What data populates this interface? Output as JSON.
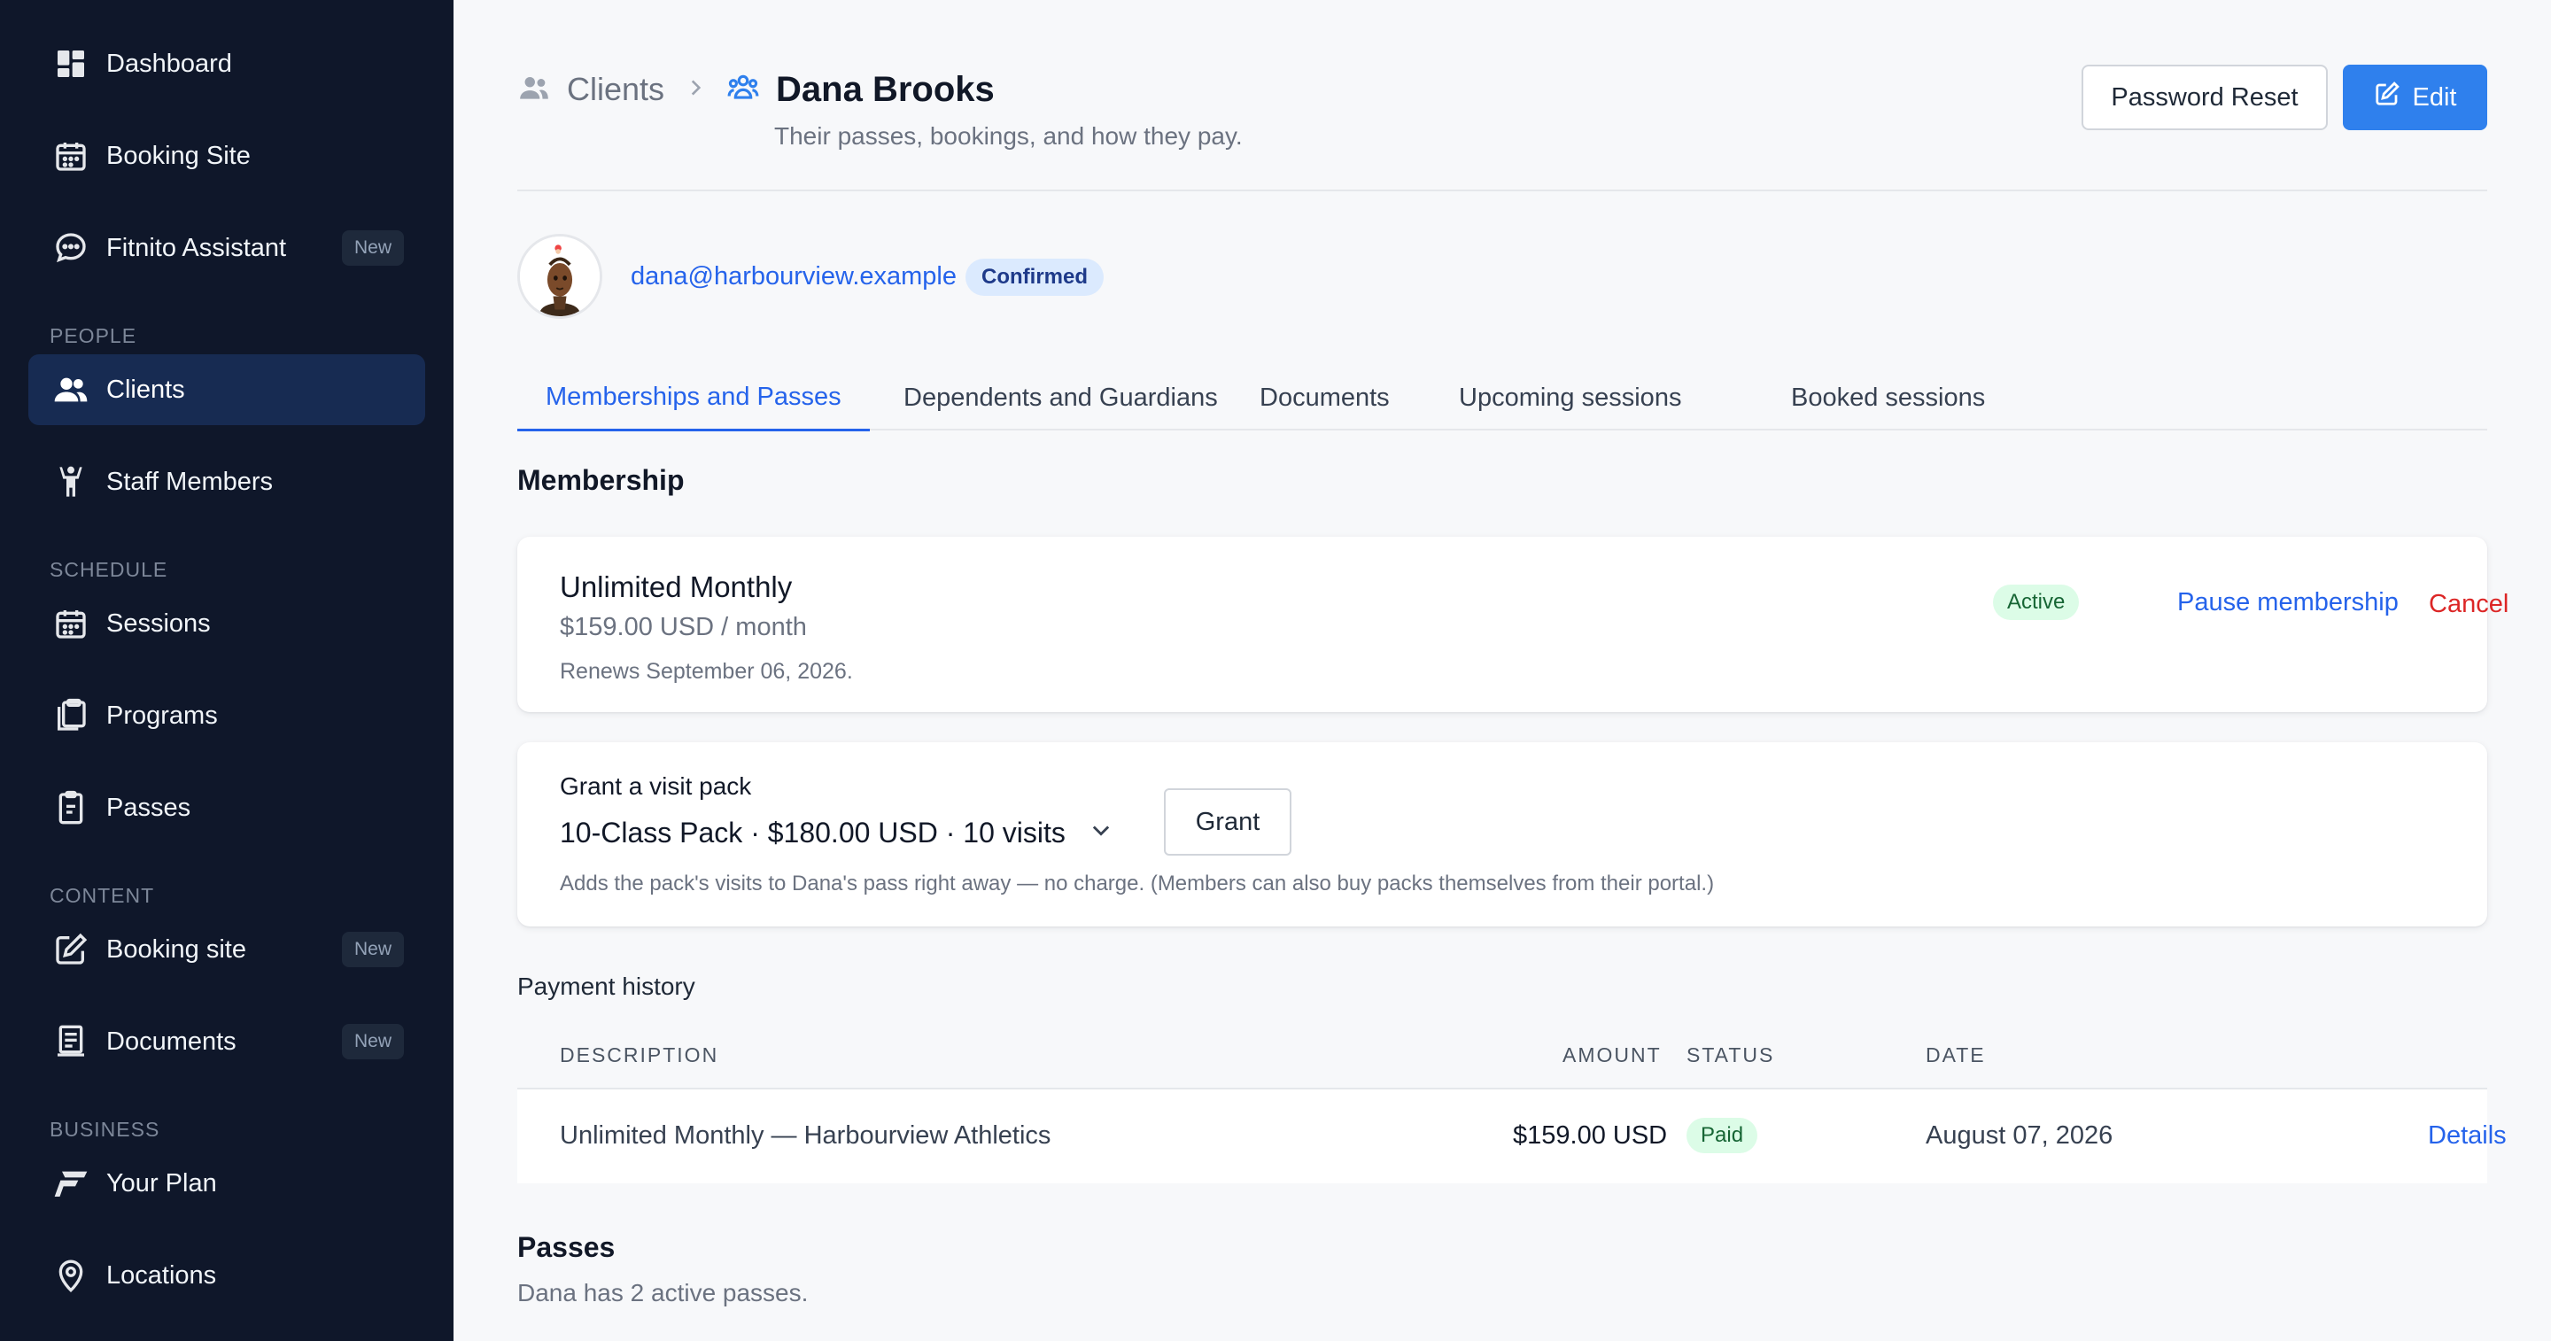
{
  "sidebar": {
    "items": [
      {
        "label": "Dashboard",
        "icon": "dashboard-icon"
      },
      {
        "label": "Booking Site",
        "icon": "calendar-icon"
      },
      {
        "label": "Fitnito Assistant",
        "icon": "chat-icon",
        "badge": "New"
      },
      {
        "label": "Clients",
        "icon": "users-icon",
        "active": true
      },
      {
        "label": "Staff Members",
        "icon": "staff-icon"
      },
      {
        "label": "Sessions",
        "icon": "calendar-icon"
      },
      {
        "label": "Programs",
        "icon": "clipboard-icon"
      },
      {
        "label": "Passes",
        "icon": "pass-icon"
      },
      {
        "label": "Booking site",
        "icon": "edit-icon",
        "badge": "New"
      },
      {
        "label": "Documents",
        "icon": "document-icon",
        "badge": "New"
      },
      {
        "label": "Your Plan",
        "icon": "fitnito-logo-icon"
      },
      {
        "label": "Locations",
        "icon": "location-icon"
      }
    ],
    "sections": {
      "people": "PEOPLE",
      "schedule": "SCHEDULE",
      "content": "CONTENT",
      "business": "BUSINESS"
    }
  },
  "header": {
    "breadcrumb_parent": "Clients",
    "title": "Dana Brooks",
    "subtitle": "Their passes, bookings, and how they pay.",
    "password_reset_label": "Password Reset",
    "edit_label": "Edit"
  },
  "profile": {
    "email": "dana@harbourview.example",
    "status": "Confirmed"
  },
  "tabs": [
    {
      "label": "Memberships and Passes",
      "active": true
    },
    {
      "label": "Dependents and Guardians"
    },
    {
      "label": "Documents"
    },
    {
      "label": "Upcoming sessions"
    },
    {
      "label": "Booked sessions"
    }
  ],
  "membership": {
    "heading": "Membership",
    "name": "Unlimited Monthly",
    "price": "$159.00 USD / month",
    "renews": "Renews September 06, 2026.",
    "status": "Active",
    "pause_label": "Pause membership",
    "cancel_label": "Cancel"
  },
  "grant": {
    "label": "Grant a visit pack",
    "selected": "10-Class Pack · $180.00 USD · 10 visits",
    "button": "Grant",
    "note": "Adds the pack's visits to Dana's pass right away — no charge. (Members can also buy packs themselves from their portal.)"
  },
  "payments": {
    "title": "Payment history",
    "columns": [
      "DESCRIPTION",
      "AMOUNT",
      "STATUS",
      "DATE"
    ],
    "rows": [
      {
        "description": "Unlimited Monthly — Harbourview Athletics",
        "amount": "$159.00 USD",
        "status": "Paid",
        "date": "August 07, 2026",
        "action": "Details"
      }
    ]
  },
  "passes": {
    "title": "Passes",
    "summary": "Dana has 2 active passes."
  },
  "colors": {
    "sidebar_bg": "#0f172a",
    "sidebar_active": "#172b52",
    "accent": "#2f80ed",
    "link": "#2563eb",
    "danger": "#dc2626",
    "success_bg": "#dcfce7",
    "success_text": "#166534"
  }
}
